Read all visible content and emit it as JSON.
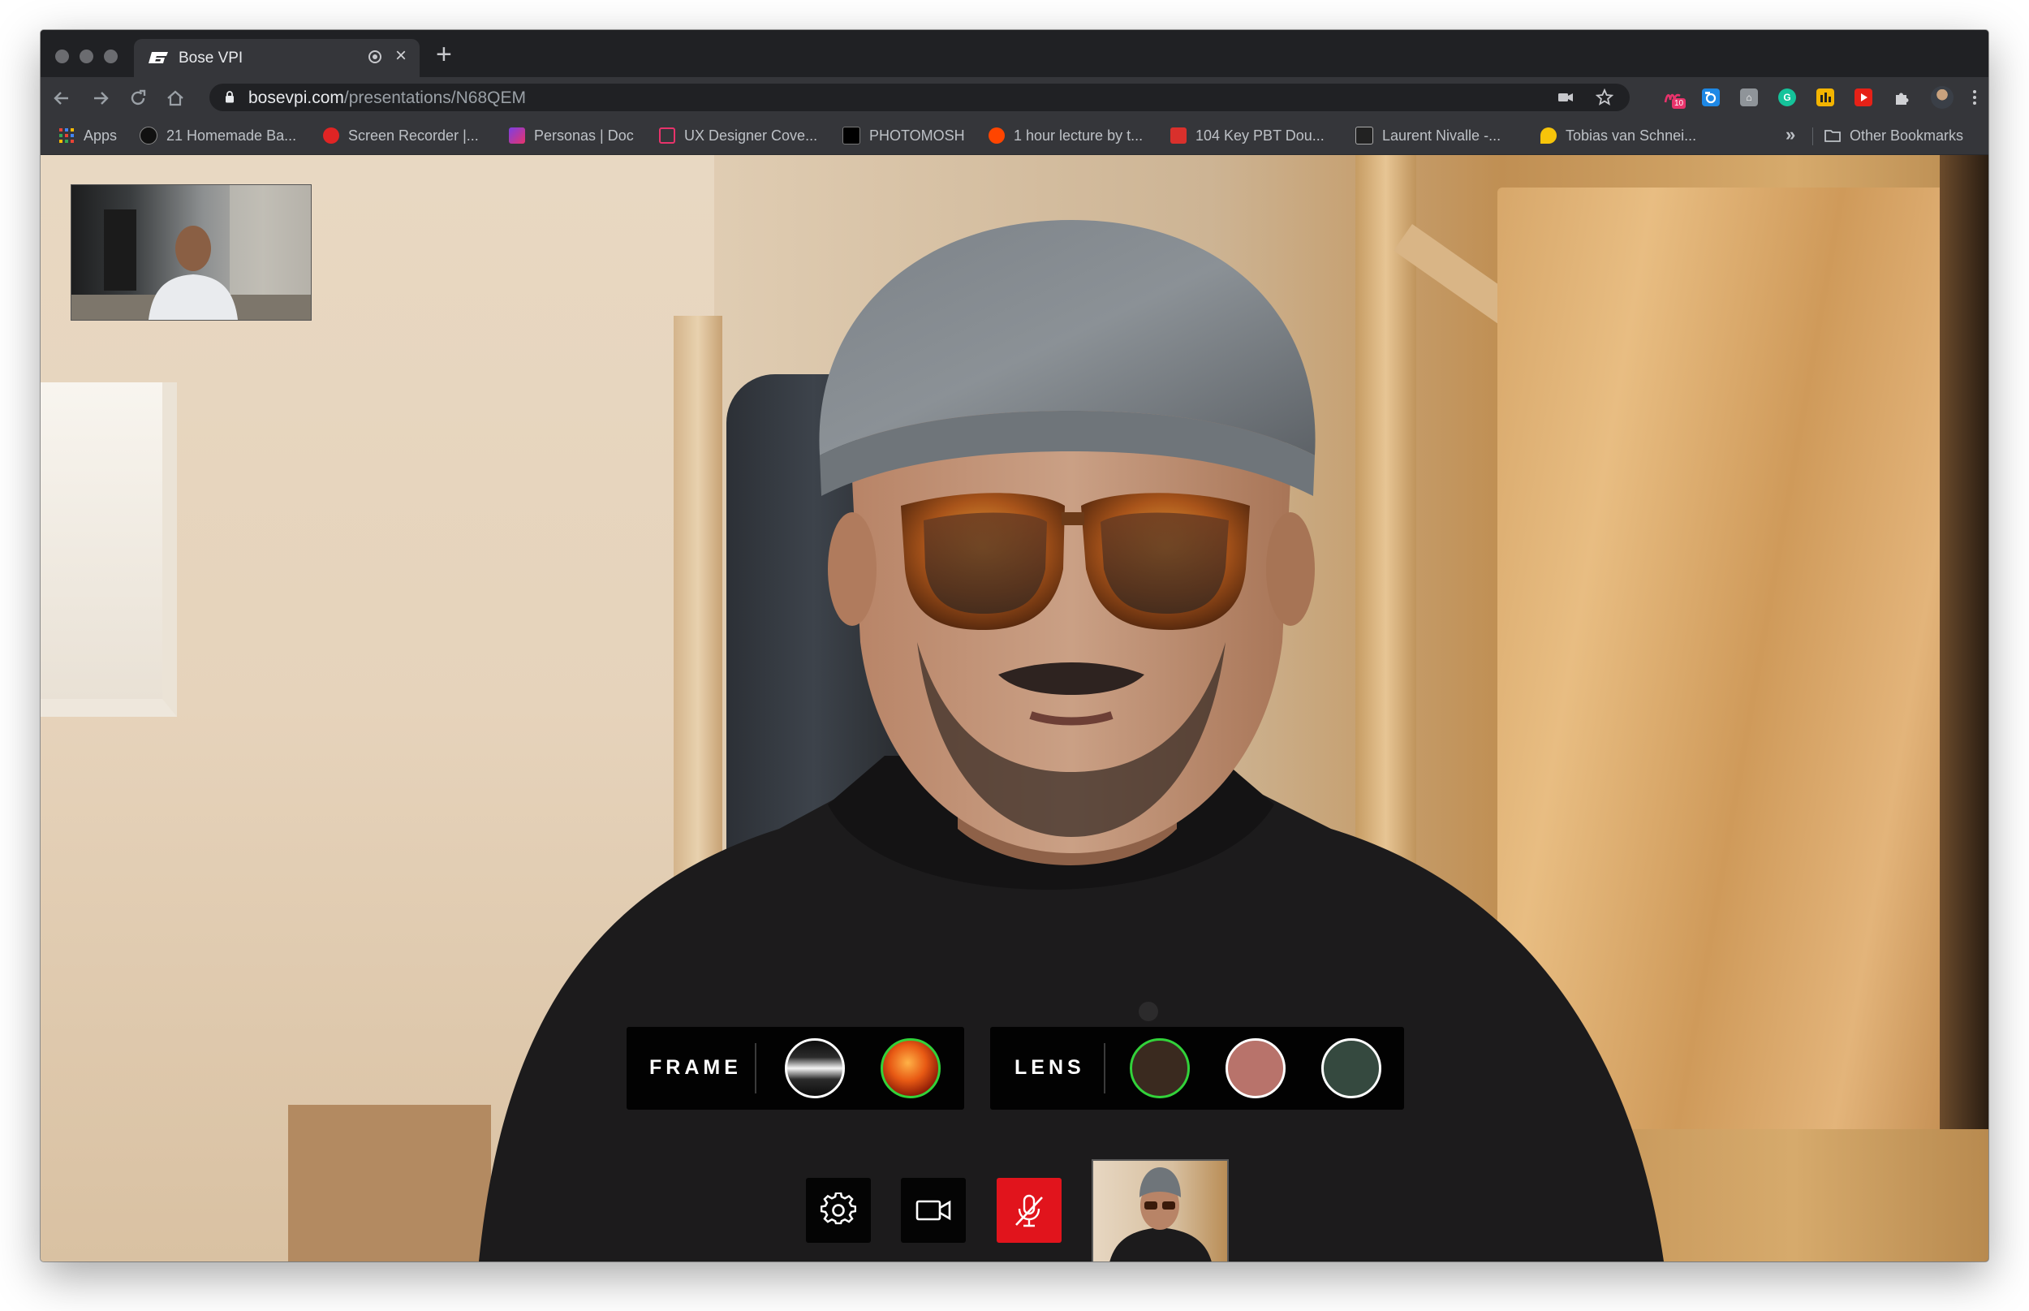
{
  "browser": {
    "tab": {
      "title": "Bose VPI"
    },
    "url": {
      "host": "bosevpi.com",
      "path": "/presentations/N68QEM"
    },
    "extensions": [
      {
        "name": "mojo-extension",
        "badge": "10",
        "color": "#e8336b"
      },
      {
        "name": "camera-extension",
        "color": "#1e88e5"
      },
      {
        "name": "tile-extension",
        "color": "#8f9499"
      },
      {
        "name": "grammarly-extension",
        "color": "#15c39a"
      },
      {
        "name": "hub-extension",
        "color": "#f3b400"
      },
      {
        "name": "youtube-extension",
        "color": "#e62117"
      }
    ],
    "bookmarks": [
      {
        "name": "bookmark-apps",
        "label": "Apps",
        "color": "#4285f4"
      },
      {
        "name": "bookmark-homemade",
        "label": "21 Homemade Ba...",
        "color": "#111111"
      },
      {
        "name": "bookmark-screen-recorder",
        "label": "Screen Recorder |...",
        "color": "#e02424"
      },
      {
        "name": "bookmark-personas",
        "label": "Personas | Doc",
        "color": "#7b3fe4"
      },
      {
        "name": "bookmark-ux-designer",
        "label": "UX Designer Cove...",
        "color": "#e8336b"
      },
      {
        "name": "bookmark-photomosh",
        "label": "PHOTOMOSH",
        "color": "#000000"
      },
      {
        "name": "bookmark-lecture",
        "label": "1 hour lecture by t...",
        "color": "#ff4500"
      },
      {
        "name": "bookmark-key-pbt",
        "label": "104 Key PBT Dou...",
        "color": "#d9302c"
      },
      {
        "name": "bookmark-laurent",
        "label": "Laurent Nivalle -...",
        "color": "#222222"
      },
      {
        "name": "bookmark-tobias",
        "label": "Tobias van Schnei...",
        "color": "#f6c40a"
      }
    ],
    "bookmarks_more": "»",
    "other_bookmarks": "Other Bookmarks"
  },
  "tryon": {
    "frame": {
      "label": "FRAME",
      "options": [
        {
          "name": "frame-swatch-black",
          "color": "#1c1c1c",
          "selected": false
        },
        {
          "name": "frame-swatch-tortoise",
          "color": "#c4491a",
          "selected": true
        }
      ]
    },
    "lens": {
      "label": "LENS",
      "options": [
        {
          "name": "lens-swatch-dark-brown",
          "color": "#3a2a1f",
          "selected": true
        },
        {
          "name": "lens-swatch-rose",
          "color": "#b8736b",
          "selected": false
        },
        {
          "name": "lens-swatch-dark-green",
          "color": "#35493f",
          "selected": false
        }
      ]
    },
    "accent_color": "#32d23a"
  },
  "call_controls": {
    "mic_muted": true,
    "mic_color": "#e1141c"
  }
}
